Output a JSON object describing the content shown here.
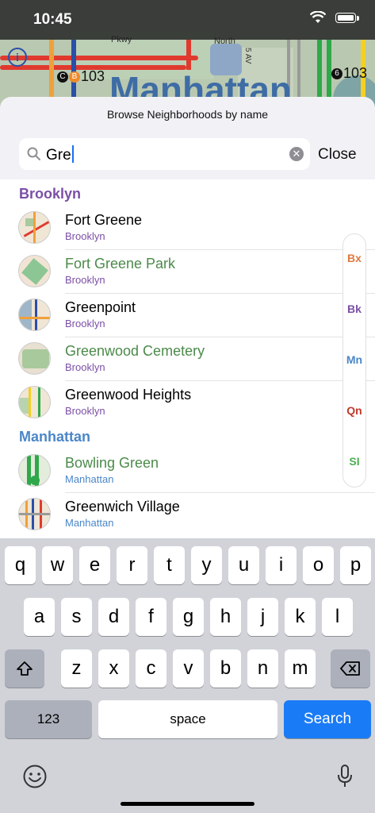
{
  "status_bar": {
    "time": "10:45"
  },
  "map": {
    "labels": {
      "borough": "Manhattan",
      "street_top": "Pkwy",
      "street_north": "North",
      "avenue": "5 AV"
    },
    "routes": [
      {
        "badge": "C",
        "badge2": "B",
        "number": "103"
      },
      {
        "badge": "6",
        "number": "103"
      }
    ]
  },
  "sheet": {
    "title": "Browse Neighborhoods by name",
    "search": {
      "value": "Gre",
      "placeholder": ""
    },
    "close_label": "Close"
  },
  "sections": [
    {
      "title": "Brooklyn",
      "color": "#7b4fa6",
      "items": [
        {
          "name": "Fort Greene",
          "borough": "Brooklyn",
          "name_color": "#000000"
        },
        {
          "name": "Fort Greene Park",
          "borough": "Brooklyn",
          "name_color": "#4b8a4a"
        },
        {
          "name": "Greenpoint",
          "borough": "Brooklyn",
          "name_color": "#000000"
        },
        {
          "name": "Greenwood Cemetery",
          "borough": "Brooklyn",
          "name_color": "#4b8a4a"
        },
        {
          "name": "Greenwood Heights",
          "borough": "Brooklyn",
          "name_color": "#000000"
        }
      ]
    },
    {
      "title": "Manhattan",
      "color": "#4a86c8",
      "items": [
        {
          "name": "Bowling Green",
          "borough": "Manhattan",
          "name_color": "#4b8a4a"
        },
        {
          "name": "Greenwich Village",
          "borough": "Manhattan",
          "name_color": "#000000"
        }
      ]
    }
  ],
  "index_bar": [
    {
      "label": "Bx",
      "color": "#e07a3f"
    },
    {
      "label": "Bk",
      "color": "#7b4fa6"
    },
    {
      "label": "Mn",
      "color": "#4a86c8"
    },
    {
      "label": "Qn",
      "color": "#c0392b"
    },
    {
      "label": "SI",
      "color": "#4caf50"
    }
  ],
  "keyboard": {
    "row1": [
      "q",
      "w",
      "e",
      "r",
      "t",
      "y",
      "u",
      "i",
      "o",
      "p"
    ],
    "row2": [
      "a",
      "s",
      "d",
      "f",
      "g",
      "h",
      "j",
      "k",
      "l"
    ],
    "row3": [
      "z",
      "x",
      "c",
      "v",
      "b",
      "n",
      "m"
    ],
    "numbers_label": "123",
    "space_label": "space",
    "search_label": "Search"
  }
}
